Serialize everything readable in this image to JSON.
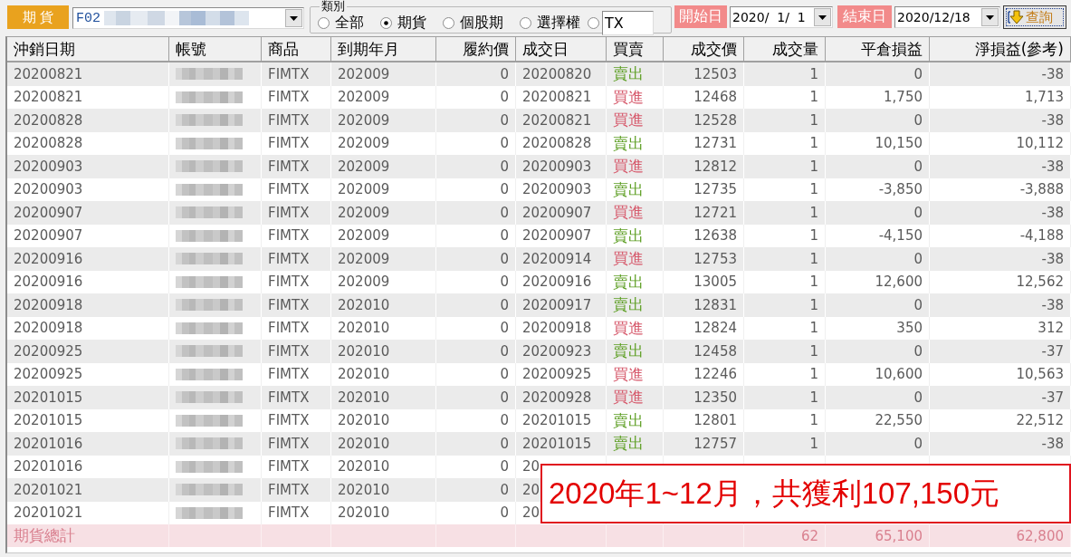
{
  "toolbar": {
    "market_label": "期 貨",
    "account": {
      "value": "F02"
    },
    "category": {
      "legend": "類別",
      "options": [
        {
          "kind": "label",
          "label": "全部",
          "selected": false
        },
        {
          "kind": "label",
          "label": "期貨",
          "selected": true
        },
        {
          "kind": "label",
          "label": "個股期",
          "selected": false
        },
        {
          "kind": "label",
          "label": "選擇權",
          "selected": false
        },
        {
          "kind": "input",
          "value": "TX",
          "selected": false
        }
      ]
    },
    "start_date": {
      "label": "開始日",
      "value": "2020/  1/  1"
    },
    "end_date": {
      "label": "結束日",
      "value": "2020/12/18"
    },
    "query_button": "查詢"
  },
  "table": {
    "columns": [
      "沖銷日期",
      "帳號",
      "商品",
      "到期年月",
      "履約價",
      "成交日",
      "買賣",
      "成交價",
      "成交量",
      "平倉損益",
      "淨損益(參考)"
    ],
    "rows": [
      {
        "close_date": "20200821",
        "product": "FIMTX",
        "expiry": "202009",
        "strike": "0",
        "trade_date": "20200820",
        "side": {
          "text": "賣出",
          "color": "#5c9e22"
        },
        "price": "12503",
        "qty": "1",
        "close_pl": "0",
        "net_pl": "-38"
      },
      {
        "close_date": "20200821",
        "product": "FIMTX",
        "expiry": "202009",
        "strike": "0",
        "trade_date": "20200821",
        "side": {
          "text": "買進",
          "color": "#d6596b"
        },
        "price": "12468",
        "qty": "1",
        "close_pl": "1,750",
        "net_pl": "1,713"
      },
      {
        "close_date": "20200828",
        "product": "FIMTX",
        "expiry": "202009",
        "strike": "0",
        "trade_date": "20200821",
        "side": {
          "text": "買進",
          "color": "#d6596b"
        },
        "price": "12528",
        "qty": "1",
        "close_pl": "0",
        "net_pl": "-38"
      },
      {
        "close_date": "20200828",
        "product": "FIMTX",
        "expiry": "202009",
        "strike": "0",
        "trade_date": "20200828",
        "side": {
          "text": "賣出",
          "color": "#5c9e22"
        },
        "price": "12731",
        "qty": "1",
        "close_pl": "10,150",
        "net_pl": "10,112"
      },
      {
        "close_date": "20200903",
        "product": "FIMTX",
        "expiry": "202009",
        "strike": "0",
        "trade_date": "20200903",
        "side": {
          "text": "買進",
          "color": "#d6596b"
        },
        "price": "12812",
        "qty": "1",
        "close_pl": "0",
        "net_pl": "-38"
      },
      {
        "close_date": "20200903",
        "product": "FIMTX",
        "expiry": "202009",
        "strike": "0",
        "trade_date": "20200903",
        "side": {
          "text": "賣出",
          "color": "#5c9e22"
        },
        "price": "12735",
        "qty": "1",
        "close_pl": "-3,850",
        "net_pl": "-3,888"
      },
      {
        "close_date": "20200907",
        "product": "FIMTX",
        "expiry": "202009",
        "strike": "0",
        "trade_date": "20200907",
        "side": {
          "text": "買進",
          "color": "#d6596b"
        },
        "price": "12721",
        "qty": "1",
        "close_pl": "0",
        "net_pl": "-38"
      },
      {
        "close_date": "20200907",
        "product": "FIMTX",
        "expiry": "202009",
        "strike": "0",
        "trade_date": "20200907",
        "side": {
          "text": "賣出",
          "color": "#5c9e22"
        },
        "price": "12638",
        "qty": "1",
        "close_pl": "-4,150",
        "net_pl": "-4,188"
      },
      {
        "close_date": "20200916",
        "product": "FIMTX",
        "expiry": "202009",
        "strike": "0",
        "trade_date": "20200914",
        "side": {
          "text": "買進",
          "color": "#d6596b"
        },
        "price": "12753",
        "qty": "1",
        "close_pl": "0",
        "net_pl": "-38"
      },
      {
        "close_date": "20200916",
        "product": "FIMTX",
        "expiry": "202009",
        "strike": "0",
        "trade_date": "20200916",
        "side": {
          "text": "賣出",
          "color": "#5c9e22"
        },
        "price": "13005",
        "qty": "1",
        "close_pl": "12,600",
        "net_pl": "12,562"
      },
      {
        "close_date": "20200918",
        "product": "FIMTX",
        "expiry": "202010",
        "strike": "0",
        "trade_date": "20200917",
        "side": {
          "text": "賣出",
          "color": "#5c9e22"
        },
        "price": "12831",
        "qty": "1",
        "close_pl": "0",
        "net_pl": "-38"
      },
      {
        "close_date": "20200918",
        "product": "FIMTX",
        "expiry": "202010",
        "strike": "0",
        "trade_date": "20200918",
        "side": {
          "text": "買進",
          "color": "#d6596b"
        },
        "price": "12824",
        "qty": "1",
        "close_pl": "350",
        "net_pl": "312"
      },
      {
        "close_date": "20200925",
        "product": "FIMTX",
        "expiry": "202010",
        "strike": "0",
        "trade_date": "20200923",
        "side": {
          "text": "賣出",
          "color": "#5c9e22"
        },
        "price": "12458",
        "qty": "1",
        "close_pl": "0",
        "net_pl": "-37"
      },
      {
        "close_date": "20200925",
        "product": "FIMTX",
        "expiry": "202010",
        "strike": "0",
        "trade_date": "20200925",
        "side": {
          "text": "買進",
          "color": "#d6596b"
        },
        "price": "12246",
        "qty": "1",
        "close_pl": "10,600",
        "net_pl": "10,563"
      },
      {
        "close_date": "20201015",
        "product": "FIMTX",
        "expiry": "202010",
        "strike": "0",
        "trade_date": "20200928",
        "side": {
          "text": "買進",
          "color": "#d6596b"
        },
        "price": "12350",
        "qty": "1",
        "close_pl": "0",
        "net_pl": "-37"
      },
      {
        "close_date": "20201015",
        "product": "FIMTX",
        "expiry": "202010",
        "strike": "0",
        "trade_date": "20201015",
        "side": {
          "text": "賣出",
          "color": "#5c9e22"
        },
        "price": "12801",
        "qty": "1",
        "close_pl": "22,550",
        "net_pl": "22,512"
      },
      {
        "close_date": "20201016",
        "product": "FIMTX",
        "expiry": "202010",
        "strike": "0",
        "trade_date": "20201015",
        "side": {
          "text": "賣出",
          "color": "#5c9e22"
        },
        "price": "12757",
        "qty": "1",
        "close_pl": "0",
        "net_pl": "-38"
      },
      {
        "close_date": "20201016",
        "product": "FIMTX",
        "expiry": "202010",
        "strike": "0",
        "trade_date": "20"
      },
      {
        "close_date": "20201021",
        "product": "FIMTX",
        "expiry": "202010",
        "strike": "0",
        "trade_date": "20"
      },
      {
        "close_date": "20201021",
        "product": "FIMTX",
        "expiry": "202010",
        "strike": "0",
        "trade_date": "20"
      }
    ],
    "total": {
      "label": "期貨總計",
      "qty": "62",
      "close_pl": "65,100",
      "net_pl": "62,800"
    }
  },
  "annotation": {
    "text": "2020年1~12月，共獲利107,150元"
  }
}
